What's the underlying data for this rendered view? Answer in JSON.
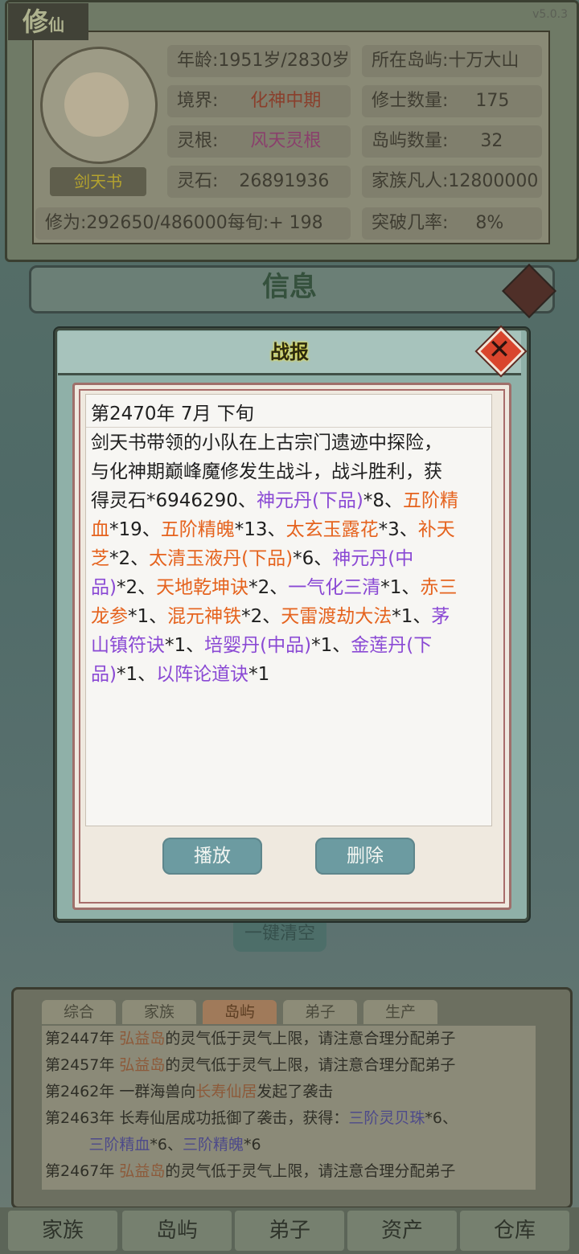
{
  "app": {
    "title_main": "修",
    "title_sub": "仙",
    "version": "v5.0.3"
  },
  "player": {
    "name": "剑天书",
    "stats": {
      "age_label": "年龄:",
      "age_value": "1951岁/2830岁",
      "island_label": "所在岛屿:",
      "island_value": "十万大山",
      "realm_label": "境界:",
      "realm_value": "化神中期",
      "cultivators_label": "修士数量:",
      "cultivators_value": "175",
      "root_label": "灵根:",
      "root_value": "风天灵根",
      "islands_label": "岛屿数量:",
      "islands_value": "32",
      "stones_label": "灵石:",
      "stones_value": "26891936",
      "mortals_label": "家族凡人:",
      "mortals_value": "12800000",
      "cultivation_label": "修为:",
      "cultivation_value": "292650/486000",
      "per_period_label": "每旬:",
      "per_period_value": "+ 198",
      "breakthrough_label": "突破几率:",
      "breakthrough_value": "8%"
    }
  },
  "info_panel": {
    "title": "信息",
    "clear_all": "一键清空"
  },
  "modal": {
    "title": "战报",
    "date": "第2470年 7月 下旬",
    "lines": [
      [
        {
          "t": "剑天书带领的小队在上古宗门遗迹中探险，",
          "c": "n"
        }
      ],
      [
        {
          "t": "与化神期巅峰魔修发生战斗，战斗胜利，获",
          "c": "n"
        }
      ],
      [
        {
          "t": "得灵石*6946290、",
          "c": "n"
        },
        {
          "t": "神元丹(下品)",
          "c": "p"
        },
        {
          "t": "*8、",
          "c": "n"
        },
        {
          "t": "五阶精",
          "c": "o"
        }
      ],
      [
        {
          "t": "血",
          "c": "o"
        },
        {
          "t": "*19、",
          "c": "n"
        },
        {
          "t": "五阶精魄",
          "c": "o"
        },
        {
          "t": "*13、",
          "c": "n"
        },
        {
          "t": "太玄玉露花",
          "c": "o"
        },
        {
          "t": "*3、",
          "c": "n"
        },
        {
          "t": "补天",
          "c": "o"
        }
      ],
      [
        {
          "t": "芝",
          "c": "o"
        },
        {
          "t": "*2、",
          "c": "n"
        },
        {
          "t": "太清玉液丹(下品)",
          "c": "o"
        },
        {
          "t": "*6、",
          "c": "n"
        },
        {
          "t": "神元丹(中",
          "c": "p"
        }
      ],
      [
        {
          "t": "品)",
          "c": "p"
        },
        {
          "t": "*2、",
          "c": "n"
        },
        {
          "t": "天地乾坤诀",
          "c": "o"
        },
        {
          "t": "*2、",
          "c": "n"
        },
        {
          "t": "一气化三清",
          "c": "p"
        },
        {
          "t": "*1、",
          "c": "n"
        },
        {
          "t": "赤三",
          "c": "o"
        }
      ],
      [
        {
          "t": "龙参",
          "c": "o"
        },
        {
          "t": "*1、",
          "c": "n"
        },
        {
          "t": "混元神铁",
          "c": "o"
        },
        {
          "t": "*2、",
          "c": "n"
        },
        {
          "t": "天雷渡劫大法",
          "c": "o"
        },
        {
          "t": "*1、",
          "c": "n"
        },
        {
          "t": "茅",
          "c": "p"
        }
      ],
      [
        {
          "t": "山镇符诀",
          "c": "p"
        },
        {
          "t": "*1、",
          "c": "n"
        },
        {
          "t": "培婴丹(中品)",
          "c": "p"
        },
        {
          "t": "*1、",
          "c": "n"
        },
        {
          "t": "金莲丹(下",
          "c": "p"
        }
      ],
      [
        {
          "t": "品)",
          "c": "p"
        },
        {
          "t": "*1、",
          "c": "n"
        },
        {
          "t": "以阵论道诀",
          "c": "p"
        },
        {
          "t": "*1",
          "c": "n"
        }
      ]
    ],
    "play_button": "播放",
    "delete_button": "删除",
    "colors": {
      "orange": "#e5631e",
      "purple": "#8a49d4",
      "normal": "#1f1f1f"
    }
  },
  "log": {
    "tabs": [
      "综合",
      "家族",
      "岛屿",
      "弟子",
      "生产"
    ],
    "active_tab": "岛屿",
    "lines": [
      [
        {
          "t": "第2447年 ",
          "c": "n"
        },
        {
          "t": "弘益岛",
          "c": "b"
        },
        {
          "t": "的灵气低于灵气上限，请注意合理分配弟子",
          "c": "n"
        }
      ],
      [
        {
          "t": "第2457年 ",
          "c": "n"
        },
        {
          "t": "弘益岛",
          "c": "b"
        },
        {
          "t": "的灵气低于灵气上限，请注意合理分配弟子",
          "c": "n"
        }
      ],
      [
        {
          "t": "第2462年 一群海兽向",
          "c": "n"
        },
        {
          "t": "长寿仙居",
          "c": "b"
        },
        {
          "t": "发起了袭击",
          "c": "n"
        }
      ],
      [
        {
          "t": "第2463年 长寿仙居成功抵御了袭击，获得：",
          "c": "n"
        },
        {
          "t": "三阶灵贝珠",
          "c": "p"
        },
        {
          "t": "*6、",
          "c": "n"
        }
      ],
      [
        {
          "t": "         ",
          "c": "n"
        },
        {
          "t": "三阶精血",
          "c": "p"
        },
        {
          "t": "*6、",
          "c": "n"
        },
        {
          "t": "三阶精魄",
          "c": "p"
        },
        {
          "t": "*6",
          "c": "n"
        }
      ],
      [
        {
          "t": "第2467年 ",
          "c": "n"
        },
        {
          "t": "弘益岛",
          "c": "b"
        },
        {
          "t": "的灵气低于灵气上限，请注意合理分配弟子",
          "c": "n"
        }
      ]
    ]
  },
  "bottom_nav": [
    "家族",
    "岛屿",
    "弟子",
    "资产",
    "仓库"
  ]
}
